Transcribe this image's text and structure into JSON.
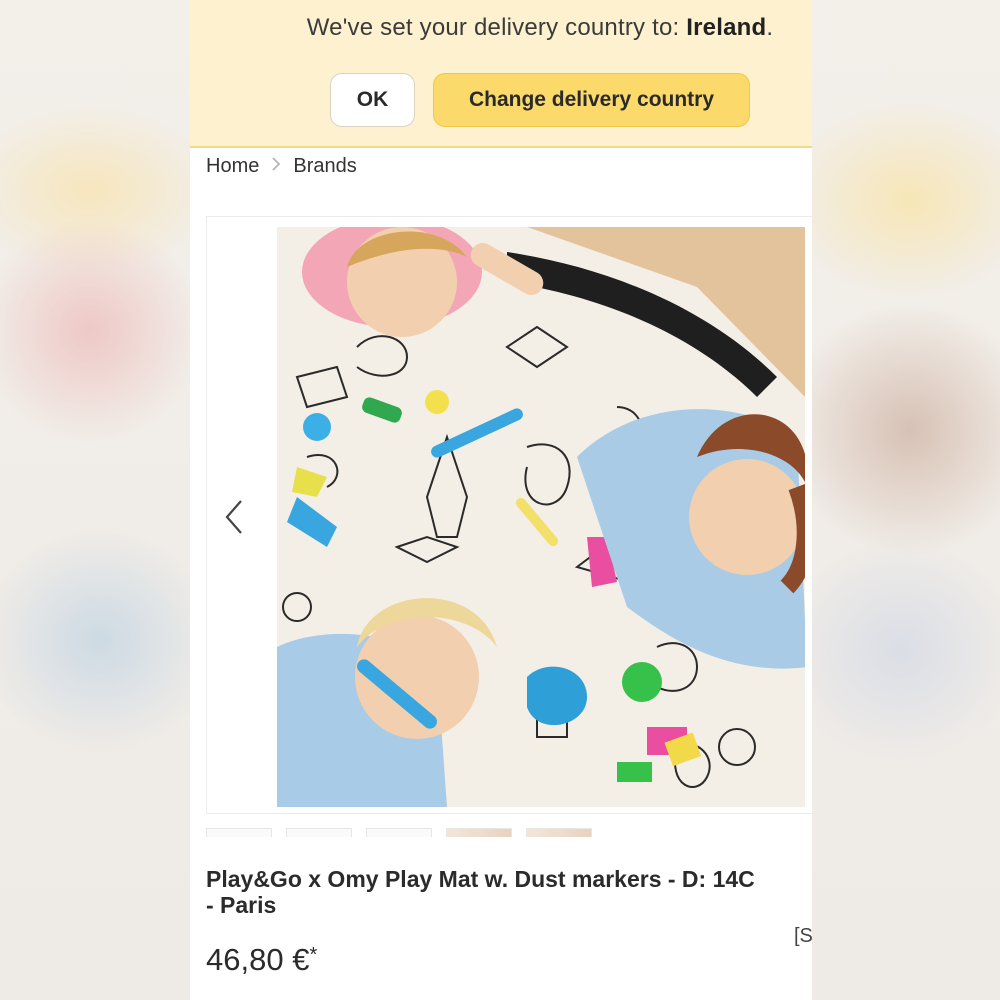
{
  "banner": {
    "message_prefix": "We've set your delivery country to: ",
    "country": "Ireland",
    "message_suffix": ".",
    "ok_label": "OK",
    "change_label": "Change delivery country",
    "background_color": "#fdf1cf",
    "accent_color": "#fbd96a"
  },
  "breadcrumb": {
    "items": [
      "Home",
      "Brands"
    ],
    "separator_icon": "chevron-right-icon"
  },
  "gallery": {
    "prev_icon": "chevron-left-icon",
    "thumbnail_count": 5
  },
  "product": {
    "title": "Play&Go x Omy Play Mat w. Dust markers - D: 14C\n- Paris",
    "price": "46,80 €",
    "price_asterisk": "*",
    "side_fragment": "[S"
  }
}
